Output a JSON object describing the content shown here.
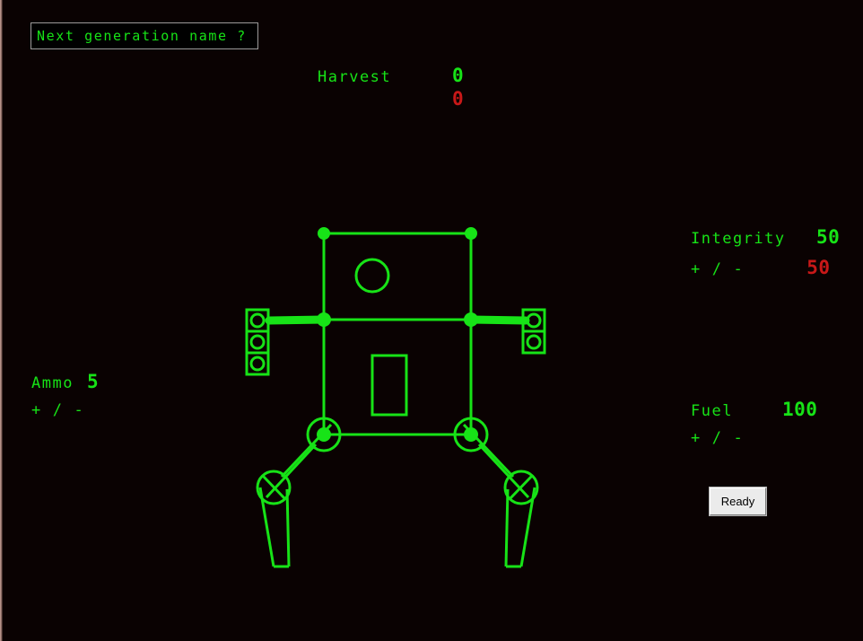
{
  "window": {
    "background_color": "#0a0202",
    "accent_color": "#17e317",
    "alert_color": "#c81818"
  },
  "name_input": {
    "value": "Next generation name ?",
    "placeholder": "Next generation name ?"
  },
  "harvest": {
    "label": "Harvest",
    "value": "0",
    "secondary_value": "0"
  },
  "integrity": {
    "label": "Integrity",
    "value": "50",
    "secondary_value": "50",
    "increase": "+",
    "separator": "/",
    "decrease": "-"
  },
  "ammo": {
    "label": "Ammo",
    "value": "5",
    "increase": "+",
    "separator": "/",
    "decrease": "-"
  },
  "fuel": {
    "label": "Fuel",
    "value": "100",
    "increase": "+",
    "separator": "/",
    "decrease": "-"
  },
  "ready_button": {
    "label": "Ready"
  },
  "mech": {
    "head": {
      "name": "head-panel",
      "eye": "sensor-eye"
    },
    "left_weapon": {
      "name": "left-weapon-magazine",
      "cells": 3
    },
    "right_weapon": {
      "name": "right-weapon-magazine",
      "cells": 2
    },
    "torso": {
      "name": "torso-frame",
      "core": "reactor-core"
    },
    "legs": {
      "left": "left-leg",
      "right": "right-leg"
    }
  }
}
